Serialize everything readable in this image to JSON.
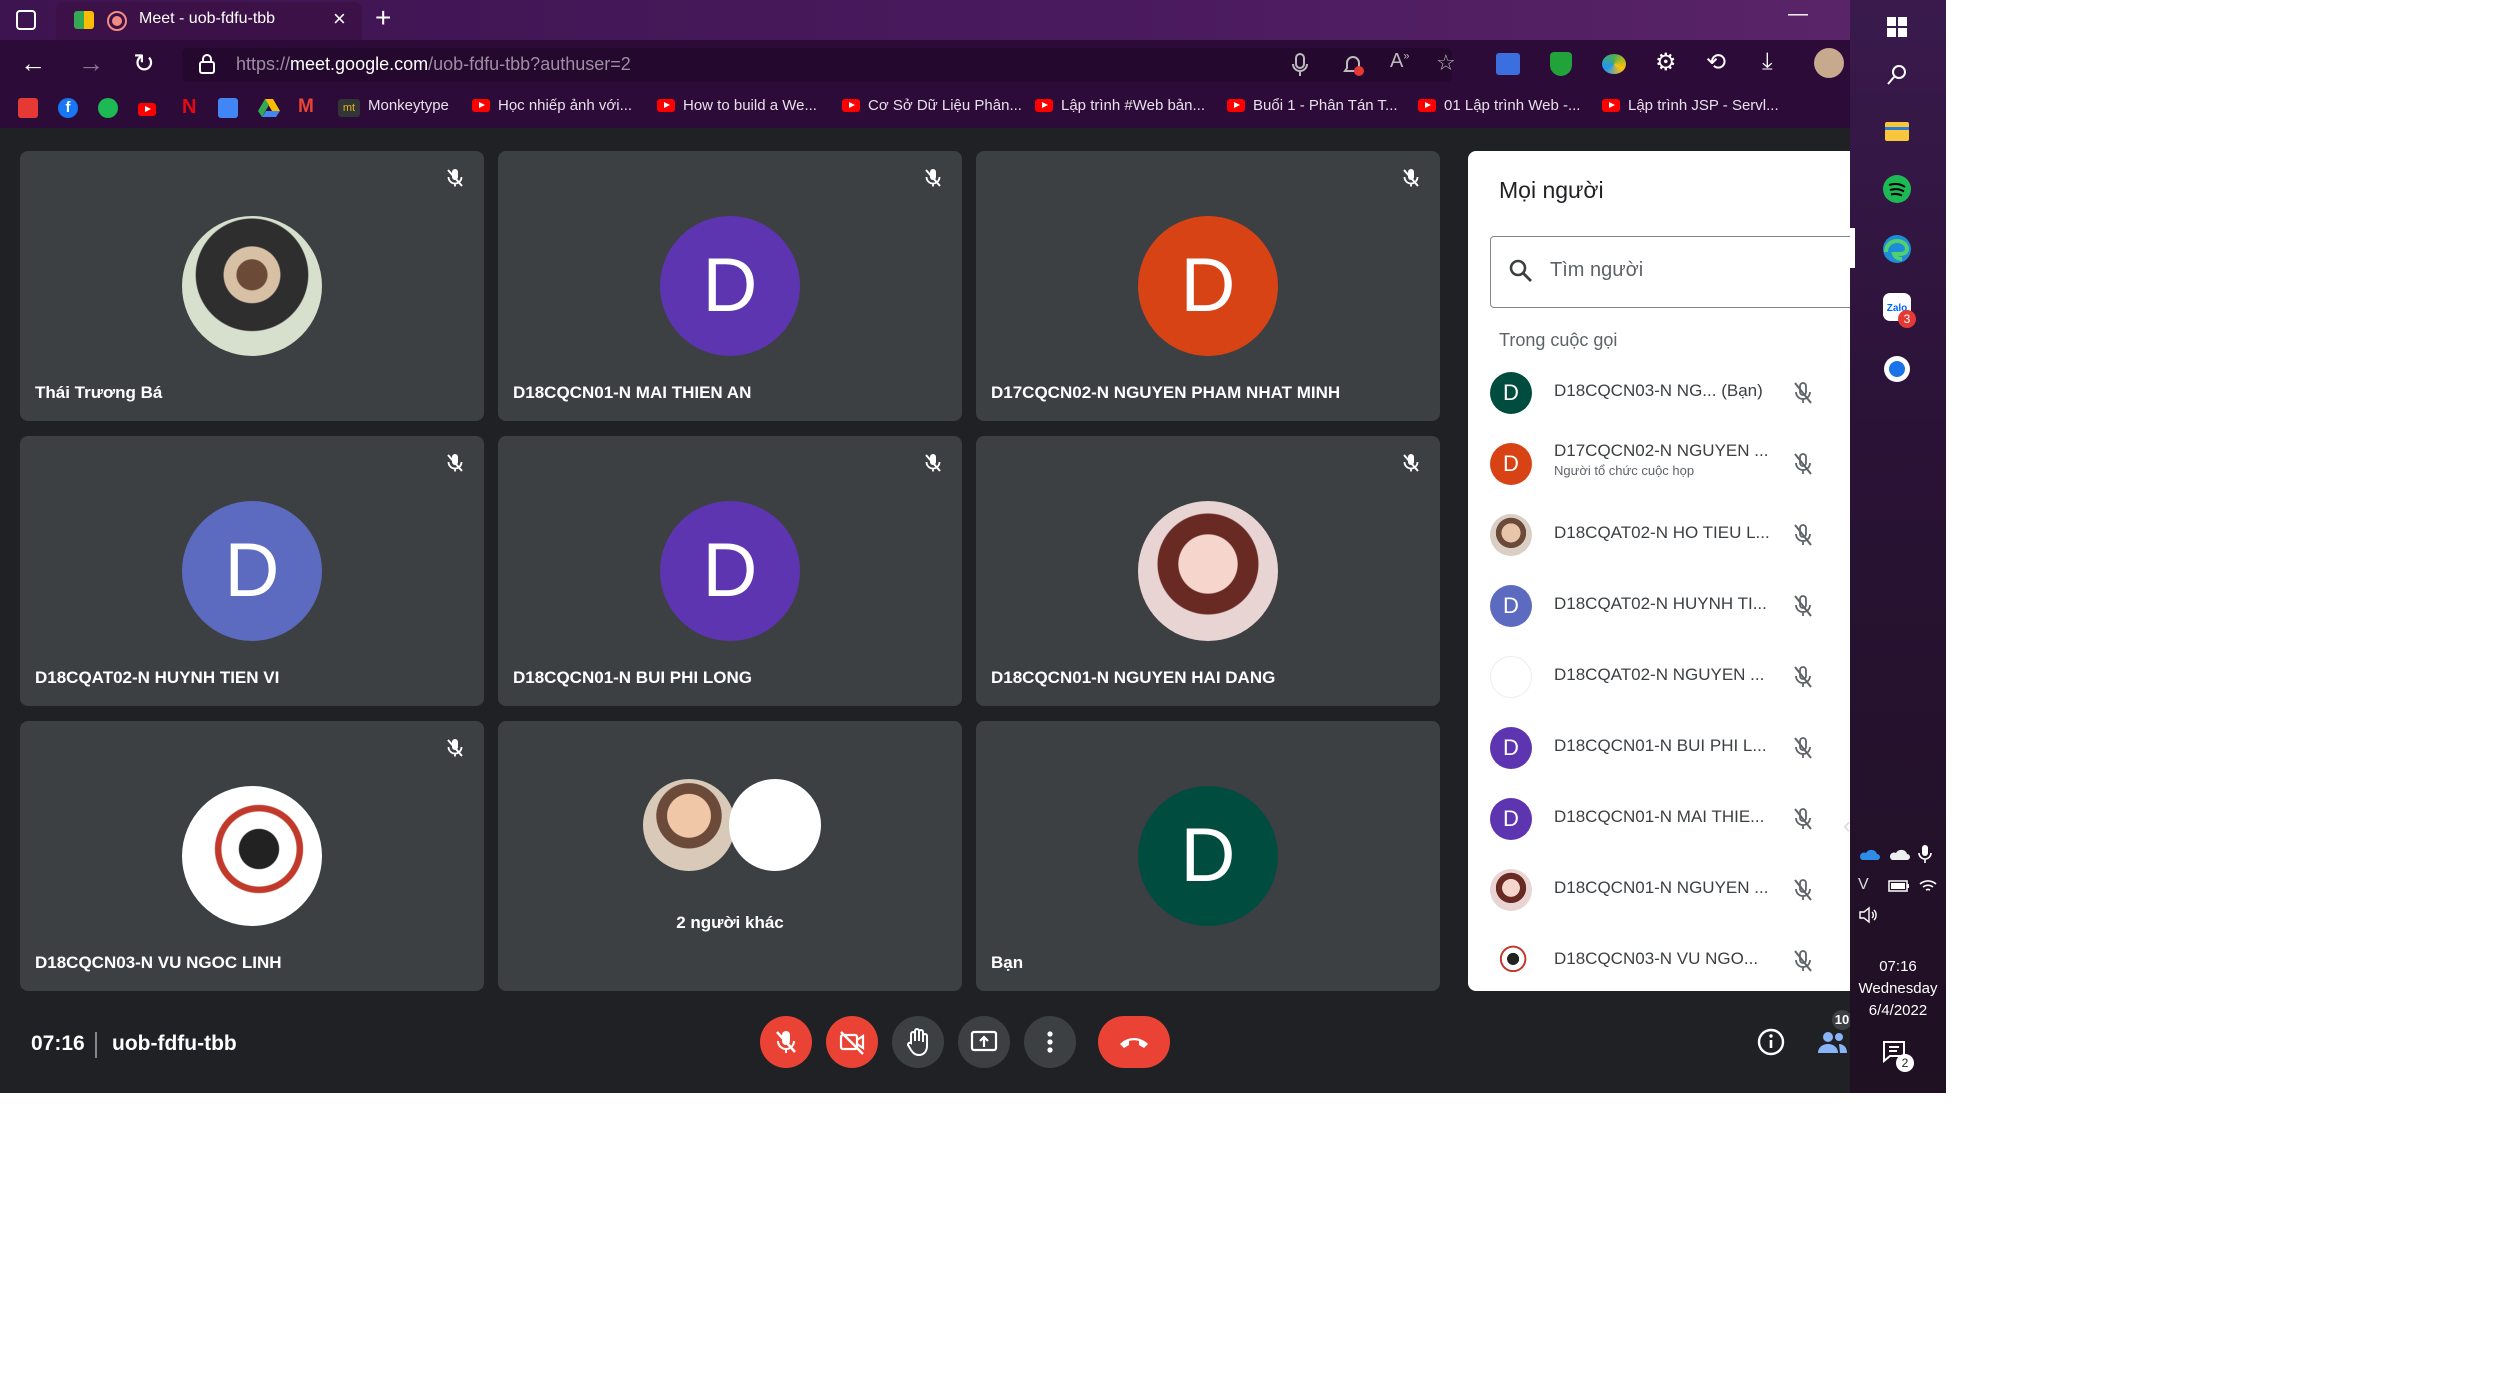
{
  "browser": {
    "tab_title": "Meet - uob-fdfu-tbb",
    "url_scheme": "https://",
    "url_host": "meet.google.com",
    "url_path": "/uob-fdfu-tbb?authuser=2",
    "bookmarks": [
      "Monkeytype",
      "Học nhiếp ảnh với...",
      "How to build a We...",
      "Cơ Sở Dữ Liệu Phân...",
      "Lập trình #Web bản...",
      "Buổi 1 - Phân Tán T...",
      "01 Lập trình Web -...",
      "Lập trình JSP - Servl..."
    ]
  },
  "tiles": [
    {
      "name": "Thái Trương Bá",
      "letter": "",
      "color": "#c9c9c9"
    },
    {
      "name": "D18CQCN01-N MAI THIEN AN",
      "letter": "D",
      "color": "#5e35b1"
    },
    {
      "name": "D17CQCN02-N NGUYEN PHAM NHAT MINH",
      "letter": "D",
      "color": "#d84315"
    },
    {
      "name": "D18CQAT02-N HUYNH TIEN VI",
      "letter": "D",
      "color": "#5c6bc0"
    },
    {
      "name": "D18CQCN01-N BUI PHI LONG",
      "letter": "D",
      "color": "#5e35b1"
    },
    {
      "name": "D18CQCN01-N NGUYEN HAI DANG",
      "letter": "",
      "color": "#e9c7c7"
    },
    {
      "name": "D18CQCN03-N VU NGOC LINH",
      "letter": "",
      "color": "#ffffff"
    },
    {
      "name": "2 người khác",
      "letter": "",
      "color": "#3c4043"
    },
    {
      "name": "Bạn",
      "letter": "D",
      "color": "#004d40"
    }
  ],
  "panel": {
    "title": "Mọi người",
    "search_placeholder": "Tìm người",
    "section_label": "Trong cuộc gọi",
    "people": [
      {
        "name": "D18CQCN03-N NG...  (Bạn)",
        "sub": "",
        "letter": "D",
        "color": "#004d40"
      },
      {
        "name": "D17CQCN02-N NGUYEN ...",
        "sub": "Người tổ chức cuộc họp",
        "letter": "D",
        "color": "#d84315"
      },
      {
        "name": "D18CQAT02-N HO TIEU L...",
        "sub": "",
        "letter": "",
        "color": "#a1887f"
      },
      {
        "name": "D18CQAT02-N HUYNH TI...",
        "sub": "",
        "letter": "D",
        "color": "#5c6bc0"
      },
      {
        "name": "D18CQAT02-N NGUYEN ...",
        "sub": "",
        "letter": "",
        "color": "#ffffff"
      },
      {
        "name": "D18CQCN01-N BUI PHI L...",
        "sub": "",
        "letter": "D",
        "color": "#5e35b1"
      },
      {
        "name": "D18CQCN01-N MAI THIE...",
        "sub": "",
        "letter": "D",
        "color": "#5e35b1"
      },
      {
        "name": "D18CQCN01-N NGUYEN ...",
        "sub": "",
        "letter": "",
        "color": "#e9c7c7"
      },
      {
        "name": "D18CQCN03-N VU NGO...",
        "sub": "",
        "letter": "",
        "color": "#ffffff"
      }
    ]
  },
  "bottom": {
    "time": "07:16",
    "meeting_code": "uob-fdfu-tbb",
    "participant_count": "10"
  },
  "taskbar": {
    "time": "07:16",
    "day": "Wednesday",
    "date": "6/4/2022",
    "badge_count": "3",
    "notif_count": "2"
  }
}
